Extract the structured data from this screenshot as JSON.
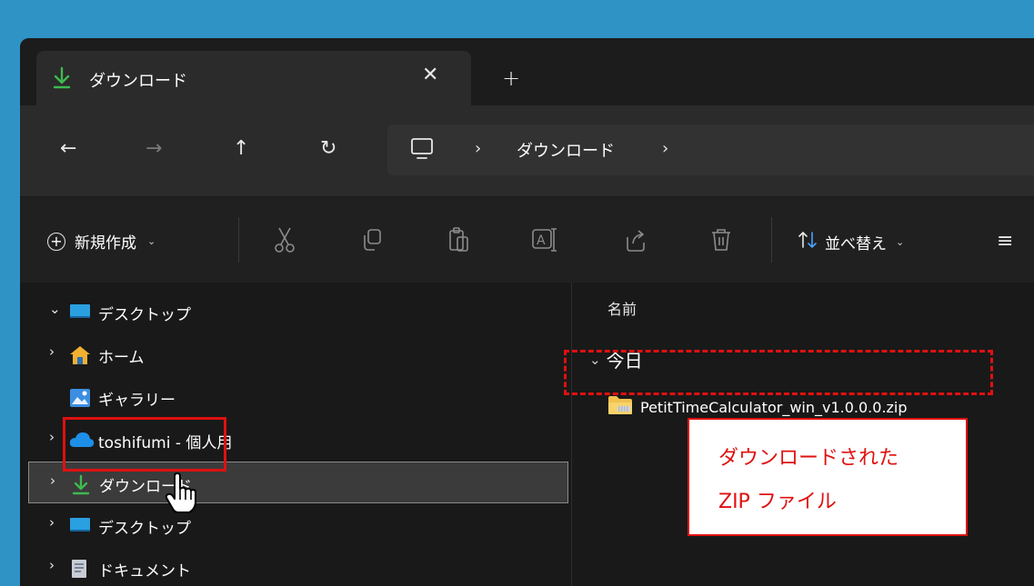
{
  "tab": {
    "title": "ダウンロード",
    "close": "✕",
    "new_tab": "+"
  },
  "nav": {
    "back": "←",
    "forward": "→",
    "up": "↑",
    "refresh": "↻"
  },
  "address": {
    "sep1": "›",
    "crumb": "ダウンロード",
    "sep2": "›"
  },
  "toolbar": {
    "new_label": "新規作成",
    "new_chevron": "⌄",
    "sort_label": "並べ替え",
    "sort_chevron": "⌄",
    "view_icon": "≡"
  },
  "tree": {
    "items": [
      {
        "chevron": "⌄",
        "label": "デスクトップ",
        "icon": "desktop-icon"
      },
      {
        "chevron": "›",
        "label": "ホーム",
        "icon": "home-icon"
      },
      {
        "chevron": "",
        "label": "ギャラリー",
        "icon": "gallery-icon"
      },
      {
        "chevron": "›",
        "label": "toshifumi - 個人用",
        "icon": "onedrive-icon"
      },
      {
        "chevron": "›",
        "label": "ダウンロード",
        "icon": "download-icon"
      },
      {
        "chevron": "›",
        "label": "デスクトップ",
        "icon": "desktop-icon"
      },
      {
        "chevron": "›",
        "label": "ドキュメント",
        "icon": "documents-icon"
      }
    ]
  },
  "files": {
    "column_name": "名前",
    "group_chevron": "⌄",
    "group_label": "今日",
    "items": [
      {
        "name": "PetitTimeCalculator_win_v1.0.0.0.zip",
        "icon": "zip-folder-icon"
      }
    ]
  },
  "callout": {
    "line1": "ダウンロードされた",
    "line2": "ZIP ファイル"
  },
  "colors": {
    "accent_green": "#3fb950",
    "annotation_red": "#e01010",
    "window_bg": "#202020"
  }
}
